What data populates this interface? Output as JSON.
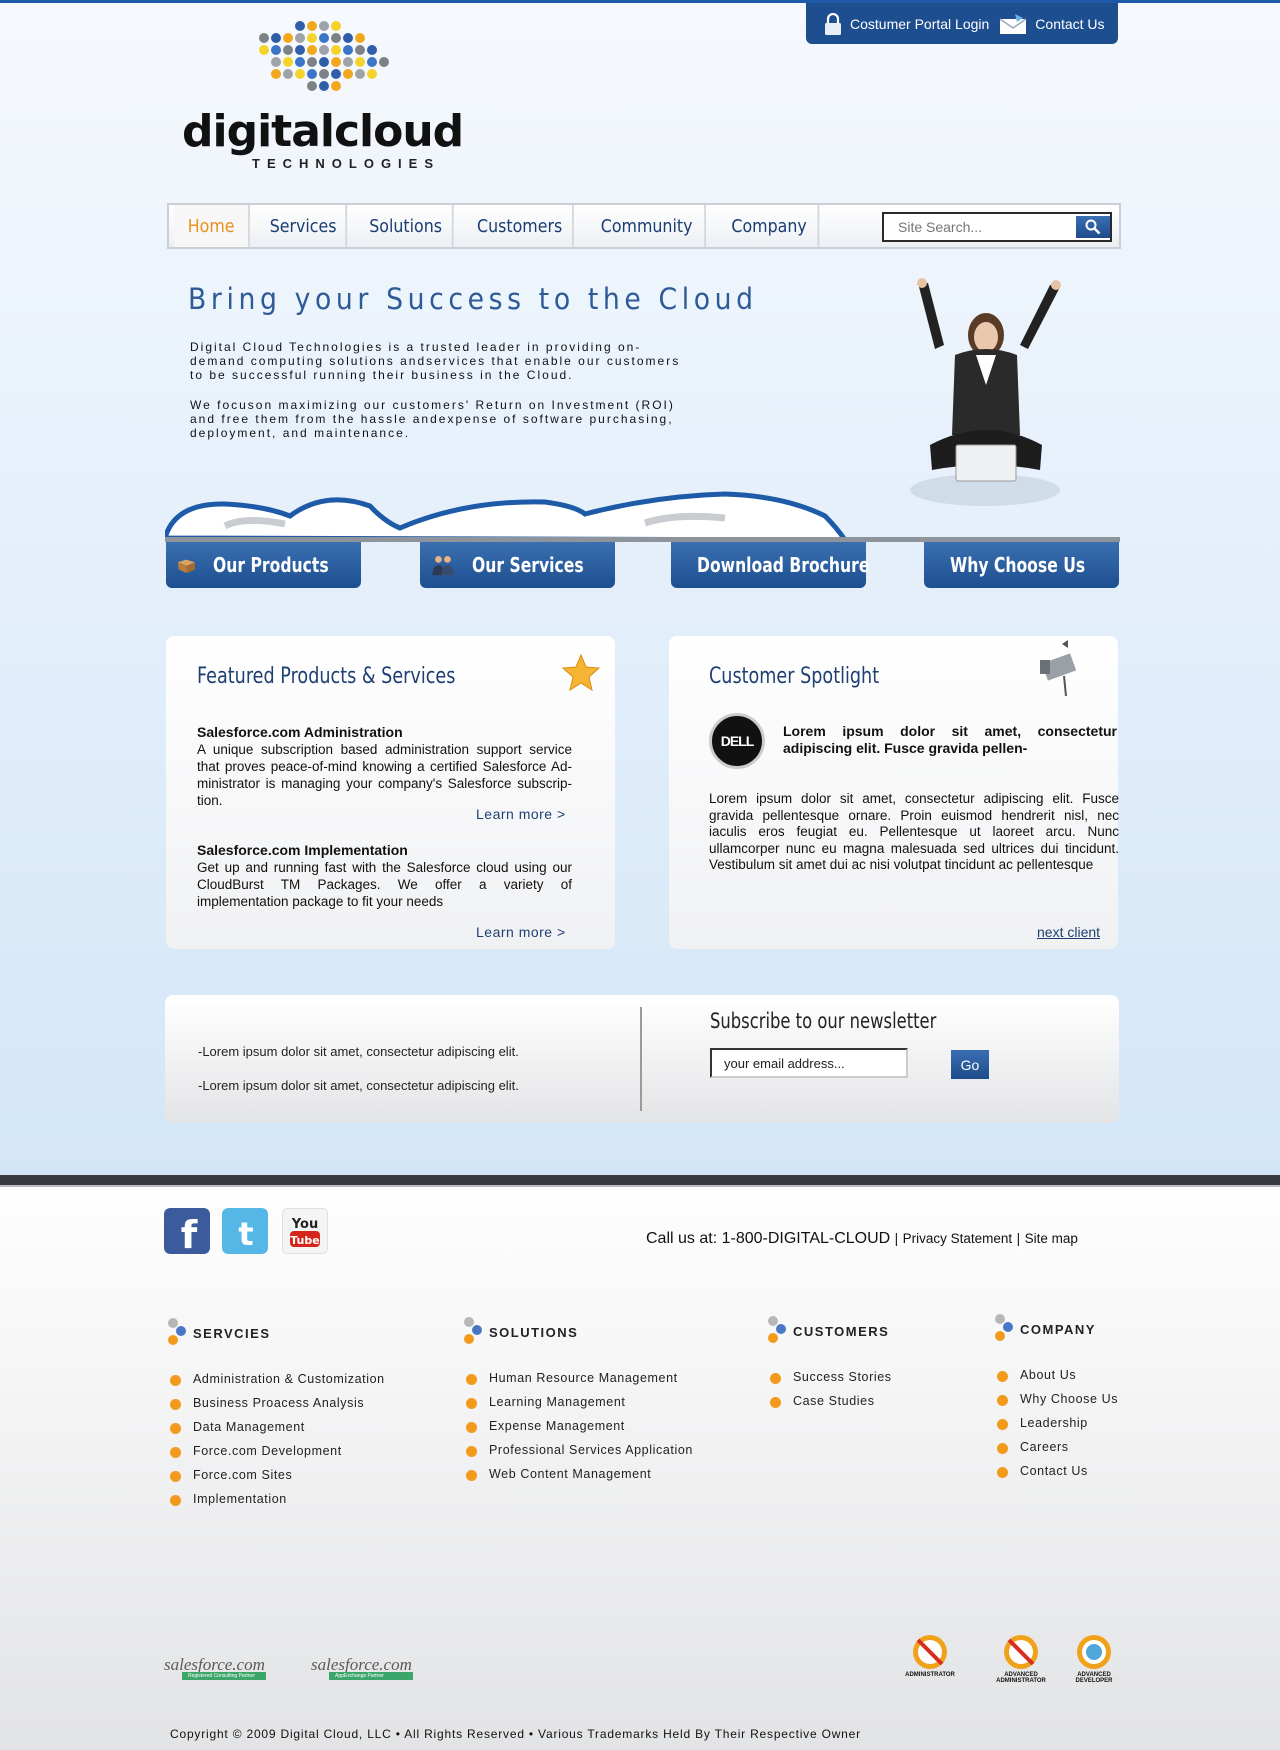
{
  "top": {
    "portal_label": "Costumer Portal Login",
    "contact_label": "Contact Us"
  },
  "logo": {
    "name": "digitalcloud",
    "tagline": "TECHNOLOGIES"
  },
  "nav": {
    "tabs": [
      "Home",
      "Services",
      "Solutions",
      "Customers",
      "Community",
      "Company"
    ],
    "active": "Home",
    "search_placeholder": "Site Search..."
  },
  "hero": {
    "title": "Bring your Success to the Cloud",
    "p1": "Digital Cloud Technologies is a trusted leader in providing on-demand computing solutions andservices that enable our customers to be successful running their business in the Cloud.",
    "p2": "We focuson maximizing our customers' Return on Investment (ROI) and free them from the hassle andexpense of software purchasing, deployment, and maintenance."
  },
  "quick_links": [
    "Our Products",
    "Our Services",
    "Download Brochure",
    "Why Choose Us"
  ],
  "featured": {
    "title": "Featured Products & Services",
    "items": [
      {
        "title": "Salesforce.com Administration",
        "body": "A unique subscription based administration support service that proves peace-of-mind knowing a certified Salesforce Ad-ministrator is managing your company's Salesforce subscrip-tion.",
        "link": "Learn more >"
      },
      {
        "title": "Salesforce.com Implementation",
        "body": "Get up and running fast with the Salesforce cloud using our CloudBurst TM Packages. We offer a variety of implementation package to fit your needs",
        "link": "Learn more >"
      }
    ]
  },
  "spotlight": {
    "title": "Customer Spotlight",
    "client_logo": "DELL",
    "lead": "Lorem ipsum dolor sit amet, consectetur adipiscing elit. Fusce gravida pellen-",
    "body": "Lorem ipsum dolor sit amet, consectetur adipiscing elit. Fusce gravida pellentesque ornare. Proin euismod hendrerit nisl, nec iaculis eros feugiat eu. Pellentesque ut laoreet arcu. Nunc ullamcorper nunc eu magna malesuada sed ultrices dui tincidunt. Vestibulum sit amet dui ac nisi volutpat tincidunt ac pellentesque",
    "next": "next client"
  },
  "newsletter": {
    "bullets": [
      "-Lorem ipsum dolor sit amet, consectetur adipiscing elit.",
      "-Lorem ipsum dolor sit amet, consectetur adipiscing elit."
    ],
    "title": "Subscribe to our newsletter",
    "input_value": "your email address...",
    "go": "Go"
  },
  "footer": {
    "call": "Call us at: 1-800-DIGITAL-CLOUD",
    "privacy": "Privacy Statement",
    "sitemap": "Site map",
    "separator": "|",
    "columns": [
      {
        "head": "SERVCIES",
        "items": [
          "Administration & Customization",
          "Business Proacess Analysis",
          "Data Management",
          "Force.com Development",
          "Force.com Sites",
          "Implementation"
        ]
      },
      {
        "head": "SOLUTIONS",
        "items": [
          "Human Resource Management",
          "Learning Management",
          "Expense Management",
          "Professional Services Application",
          "Web Content Management"
        ]
      },
      {
        "head": "CUSTOMERS",
        "items": [
          "Success Stories",
          "Case Studies"
        ]
      },
      {
        "head": "COMPANY",
        "items": [
          "About Us",
          "Why Choose Us",
          "Leadership",
          "Careers",
          "Contact Us"
        ]
      }
    ],
    "partners": [
      {
        "logo": "salesforce.com",
        "label": "Registered Consulting Partner"
      },
      {
        "logo": "salesforce.com",
        "label": "AppExchange Partner"
      }
    ],
    "badges": [
      {
        "label": "ADMINISTRATOR"
      },
      {
        "label": "ADVANCED ADMINISTRATOR"
      },
      {
        "label": "ADVANCED DEVELOPER"
      }
    ],
    "copyright": "Copyright © 2009 Digital Cloud, LLC  • All Rights Reserved  • Various Trademarks Held By Their Respective Owner"
  },
  "colors": {
    "brand_blue": "#1d4e8f",
    "accent_orange": "#f29a1b",
    "title_blue": "#2e5a98"
  }
}
